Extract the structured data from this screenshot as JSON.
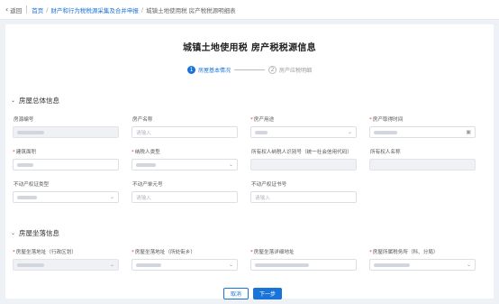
{
  "topbar": {
    "back_label": "返回",
    "breadcrumbs": [
      "首页",
      "财产和行为税税源采集及合并申报",
      "城镇土地使用税 房产税税源明细表"
    ]
  },
  "page": {
    "title": "城镇土地使用税 房产税税源信息"
  },
  "steps": [
    {
      "num": "1",
      "label": "房屋基本情况"
    },
    {
      "num": "2",
      "label": "房产应税明细"
    }
  ],
  "section1": {
    "title": "房屋总体信息",
    "fields": {
      "house_no": {
        "label": "房源编号",
        "required": ""
      },
      "house_name": {
        "label": "房产名称",
        "required": "",
        "placeholder": "请输入"
      },
      "house_use": {
        "label": "房产用途",
        "required": "*"
      },
      "acquire_time": {
        "label": "房产取得时间",
        "required": "*"
      },
      "building_area": {
        "label": "建筑面积",
        "required": "*"
      },
      "taxpayer_type": {
        "label": "纳税人类型",
        "required": "*"
      },
      "owner_id": {
        "label": "所有权人纳税人识别号（统一社会信用代码）",
        "required": ""
      },
      "owner_name": {
        "label": "所有权人名称",
        "required": ""
      },
      "cert_type": {
        "label": "不动产权证类型",
        "required": ""
      },
      "unit_no": {
        "label": "不动产单元号",
        "required": "",
        "placeholder": "请输入"
      },
      "cert_no": {
        "label": "不动产权证书号",
        "required": "",
        "placeholder": "请输入"
      }
    }
  },
  "section2": {
    "title": "房屋坐落信息",
    "fields": {
      "addr_district": {
        "label": "房屋坐落地址（行政区划）",
        "required": "*"
      },
      "addr_street": {
        "label": "房屋坐落地址（所处街乡）",
        "required": "*"
      },
      "addr_detail": {
        "label": "房屋坐落详细地址",
        "required": "*"
      },
      "tax_office": {
        "label": "房屋所属税务所（科、分局）",
        "required": "*"
      }
    }
  },
  "buttons": {
    "cancel": "取消",
    "next": "下一步"
  },
  "icons": {
    "back": "chevron-left-icon",
    "dropdown": "chevron-down-icon",
    "calendar": "calendar-icon",
    "section_toggle": "chevron-down-icon"
  },
  "colors": {
    "accent": "#1a73d9",
    "required": "#e23c3c"
  }
}
